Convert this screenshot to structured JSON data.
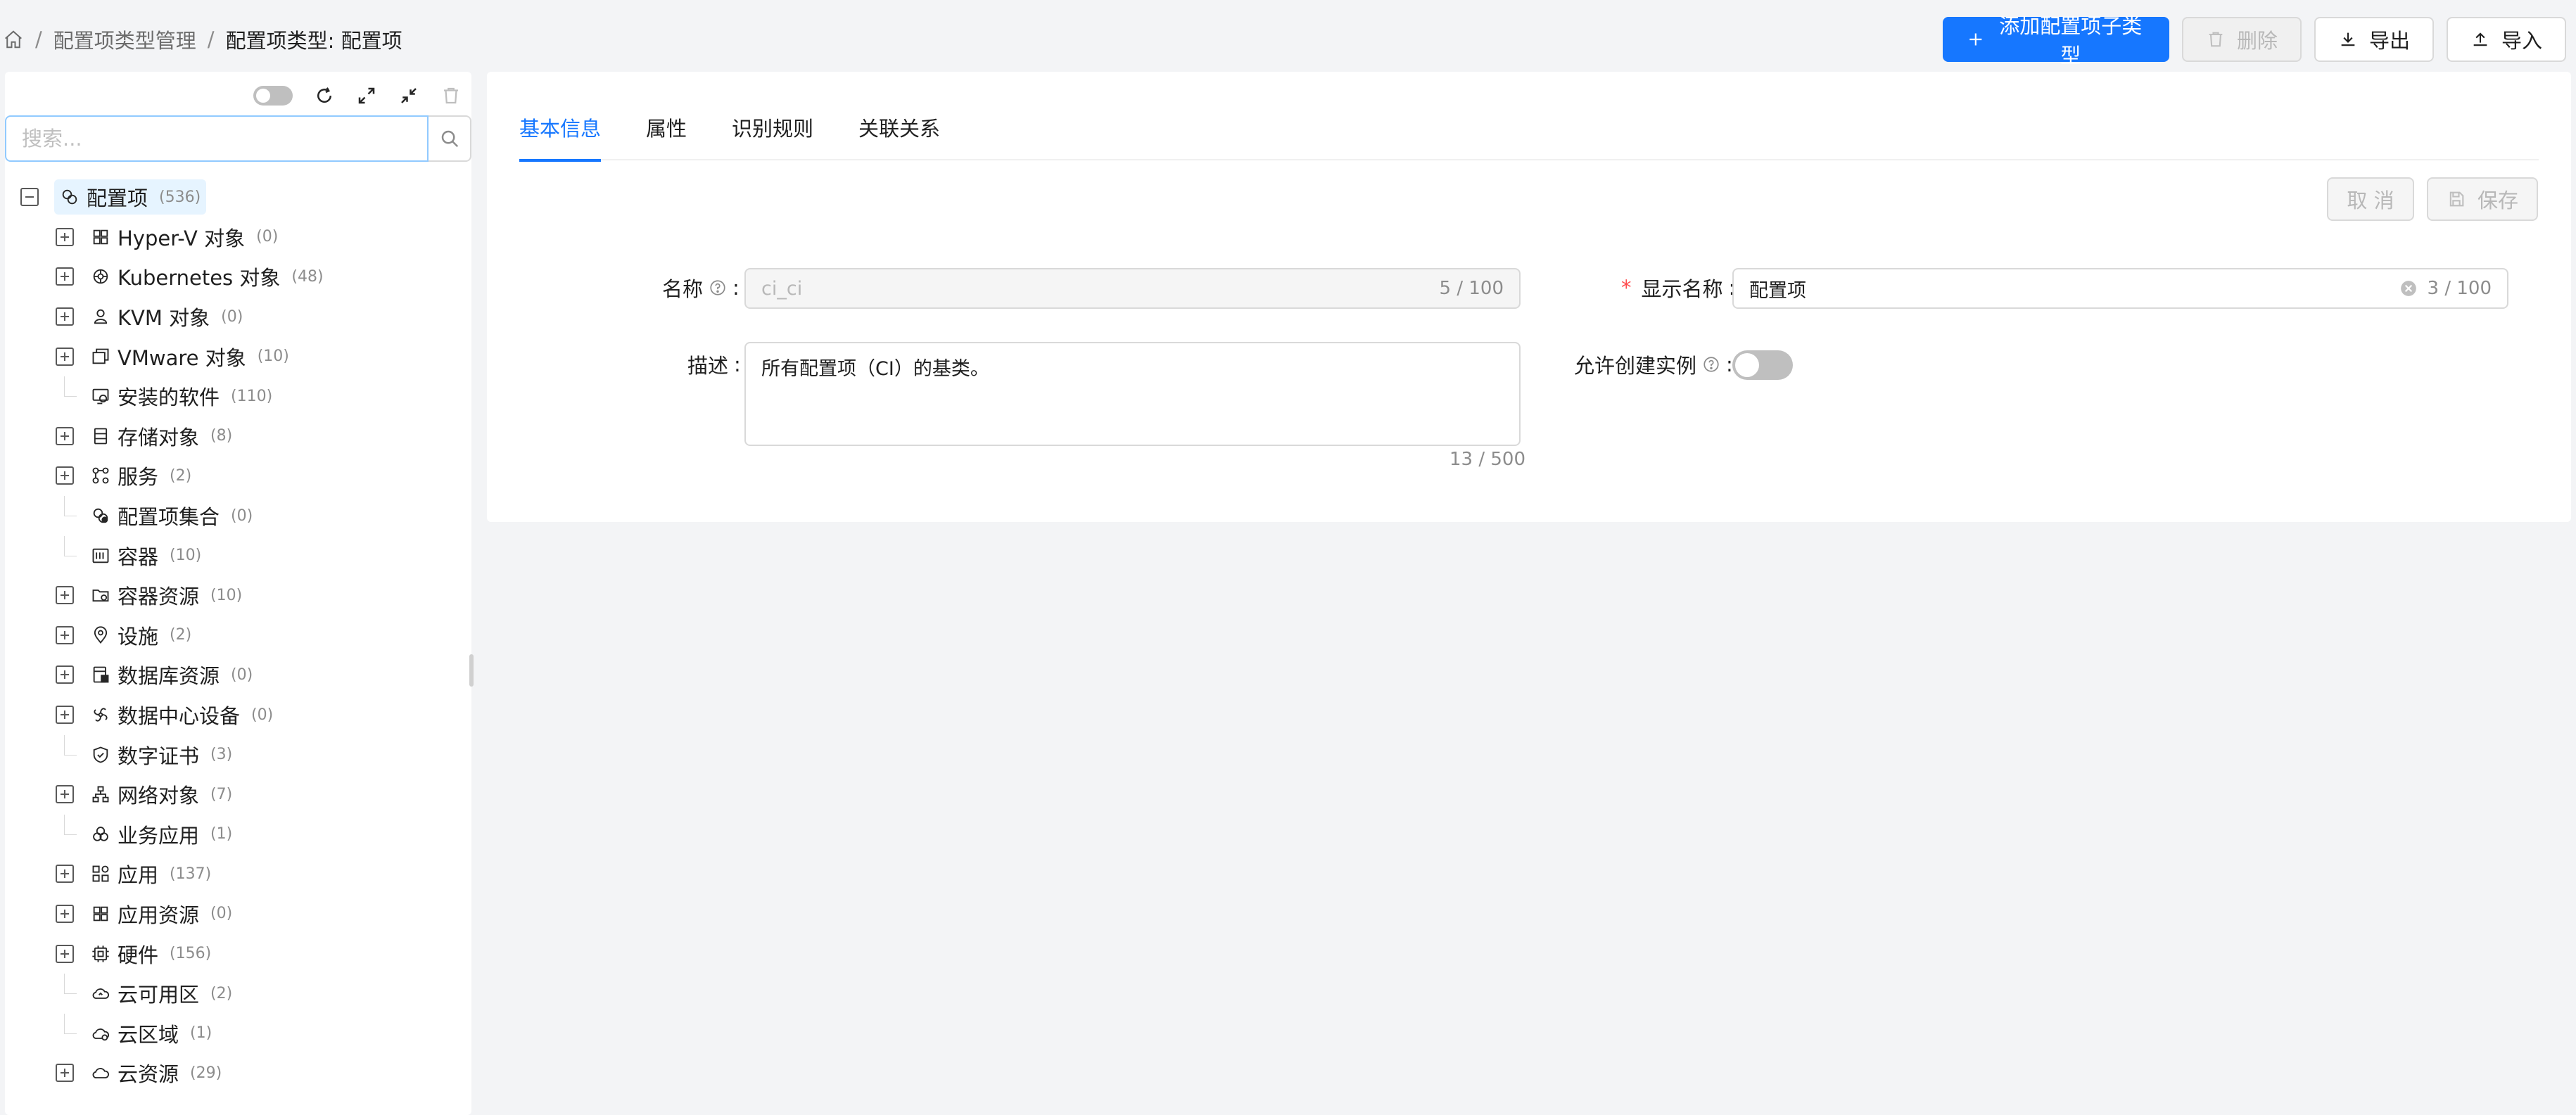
{
  "breadcrumb": {
    "items": [
      "配置项类型管理",
      "配置项类型: 配置项"
    ],
    "separator": "/"
  },
  "header_actions": {
    "add_label": "添加配置项子类型",
    "delete_label": "删除",
    "export_label": "导出",
    "import_label": "导入"
  },
  "colors": {
    "primary": "#1677ff",
    "selected_bg": "#e6f4ff",
    "required": "#ff4d4f"
  },
  "tree": {
    "search_placeholder": "搜索...",
    "root": {
      "label": "配置项",
      "count": "(536)",
      "icon": "ci-icon"
    },
    "items": [
      {
        "label": "Hyper-V 对象",
        "count": "(0)",
        "expandable": true,
        "icon": "hyperv-icon"
      },
      {
        "label": "Kubernetes 对象",
        "count": "(48)",
        "expandable": true,
        "icon": "kubernetes-icon"
      },
      {
        "label": "KVM 对象",
        "count": "(0)",
        "expandable": true,
        "icon": "kvm-icon"
      },
      {
        "label": "VMware 对象",
        "count": "(10)",
        "expandable": true,
        "icon": "vmware-icon"
      },
      {
        "label": "安装的软件",
        "count": "(110)",
        "expandable": false,
        "icon": "installed-software-icon"
      },
      {
        "label": "存储对象",
        "count": "(8)",
        "expandable": true,
        "icon": "storage-icon"
      },
      {
        "label": "服务",
        "count": "(2)",
        "expandable": true,
        "icon": "service-icon"
      },
      {
        "label": "配置项集合",
        "count": "(0)",
        "expandable": false,
        "icon": "ci-collection-icon"
      },
      {
        "label": "容器",
        "count": "(10)",
        "expandable": false,
        "icon": "container-icon"
      },
      {
        "label": "容器资源",
        "count": "(10)",
        "expandable": true,
        "icon": "container-resource-icon"
      },
      {
        "label": "设施",
        "count": "(2)",
        "expandable": true,
        "icon": "facility-icon"
      },
      {
        "label": "数据库资源",
        "count": "(0)",
        "expandable": true,
        "icon": "database-icon"
      },
      {
        "label": "数据中心设备",
        "count": "(0)",
        "expandable": true,
        "icon": "datacenter-device-icon"
      },
      {
        "label": "数字证书",
        "count": "(3)",
        "expandable": false,
        "icon": "certificate-icon"
      },
      {
        "label": "网络对象",
        "count": "(7)",
        "expandable": true,
        "icon": "network-icon"
      },
      {
        "label": "业务应用",
        "count": "(1)",
        "expandable": false,
        "icon": "business-app-icon"
      },
      {
        "label": "应用",
        "count": "(137)",
        "expandable": true,
        "icon": "application-icon"
      },
      {
        "label": "应用资源",
        "count": "(0)",
        "expandable": true,
        "icon": "app-resource-icon"
      },
      {
        "label": "硬件",
        "count": "(156)",
        "expandable": true,
        "icon": "hardware-icon"
      },
      {
        "label": "云可用区",
        "count": "(2)",
        "expandable": false,
        "icon": "cloud-zone-icon"
      },
      {
        "label": "云区域",
        "count": "(1)",
        "expandable": false,
        "icon": "cloud-region-icon"
      },
      {
        "label": "云资源",
        "count": "(29)",
        "expandable": true,
        "icon": "cloud-resource-icon"
      }
    ]
  },
  "tabs": [
    "基本信息",
    "属性",
    "识别规则",
    "关联关系"
  ],
  "active_tab": "基本信息",
  "form_actions": {
    "cancel_label": "取 消",
    "save_label": "保存"
  },
  "form": {
    "name_label": "名称",
    "name_value": "ci_ci",
    "name_count": "5 / 100",
    "display_name_label": "显示名称",
    "display_name_value": "配置项",
    "display_name_count": "3 / 100",
    "description_label": "描述",
    "description_value": "所有配置项（CI）的基类。",
    "description_count": "13 / 500",
    "allow_instance_label": "允许创建实例",
    "allow_instance_on": false,
    "colon": ":"
  }
}
